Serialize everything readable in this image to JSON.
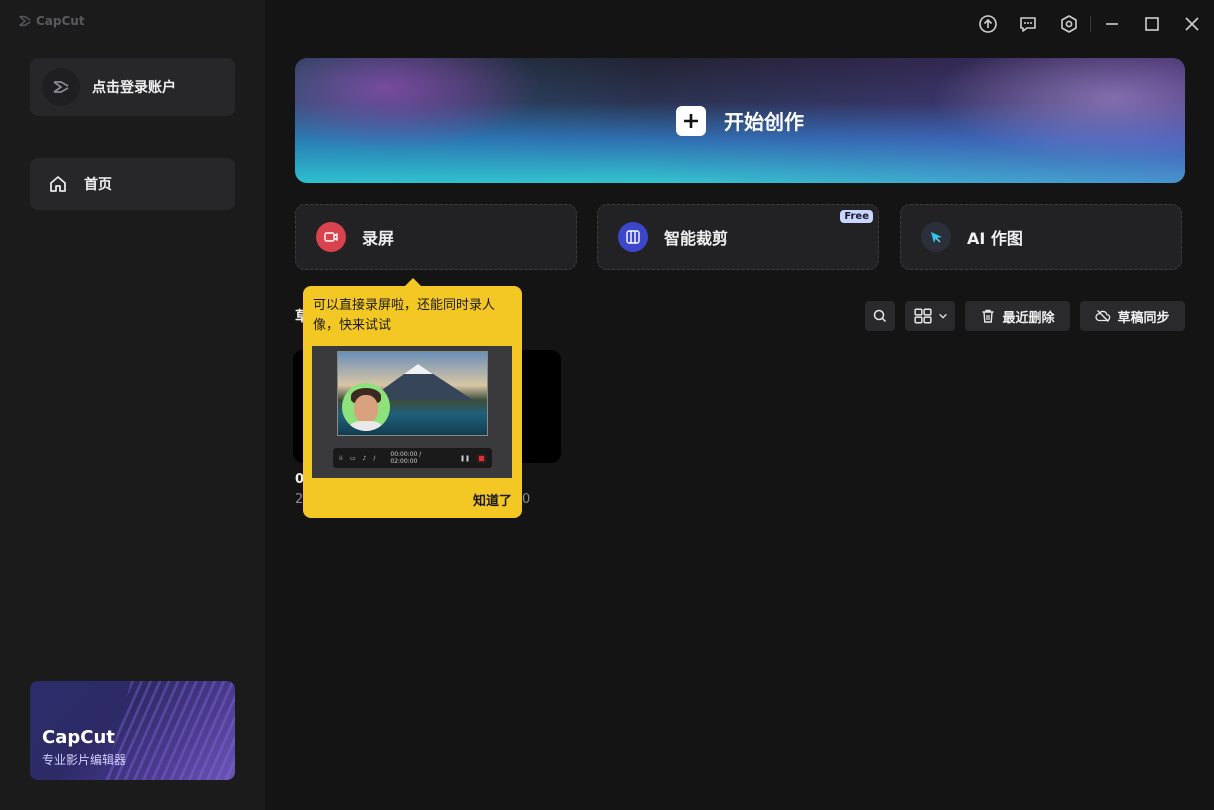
{
  "app": {
    "logo_text": "CapCut"
  },
  "sidebar": {
    "login_label": "点击登录账户",
    "nav": [
      {
        "label": "首页",
        "icon": "home-icon"
      }
    ],
    "promo": {
      "title": "CapCut",
      "subtitle": "专业影片编辑器"
    }
  },
  "titlebar": {
    "icons": [
      "upload-icon",
      "feedback-icon",
      "settings-icon",
      "minimize-icon",
      "maximize-icon",
      "close-icon"
    ]
  },
  "hero": {
    "label": "开始创作"
  },
  "features": [
    {
      "label": "录屏",
      "icon": "record-screen-icon",
      "color": "#d9434d"
    },
    {
      "label": "智能裁剪",
      "icon": "smart-crop-icon",
      "color": "#3b46c9",
      "badge": "Free"
    },
    {
      "label": "AI 作图",
      "icon": "ai-draw-icon",
      "color": "#2a2f3a"
    }
  ],
  "drafts": {
    "title_partial": "草",
    "name_partial": "0",
    "meta_start": "2",
    "meta_end": "0"
  },
  "toolbar": {
    "recent_delete_label": "最近删除",
    "sync_label": "草稿同步"
  },
  "tooltip": {
    "text": "可以直接录屏啦，还能同时录人像，快来试试",
    "button_label": "知道了",
    "preview_time": "00:00:00 / 02:00:00"
  }
}
